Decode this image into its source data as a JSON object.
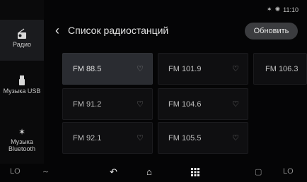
{
  "status": {
    "bluetooth_icon": "bluetooth-icon",
    "signal_icon": "network-icon",
    "time": "11:10"
  },
  "sidebar": {
    "items": [
      {
        "label": "Радио",
        "icon": "radio-icon",
        "active": true
      },
      {
        "label": "Музыка USB",
        "icon": "usb-icon",
        "active": false
      },
      {
        "label": "Музыка Bluetooth",
        "icon": "bluetooth-icon",
        "active": false
      }
    ]
  },
  "header": {
    "title": "Список радиостанций",
    "back_icon": "back-chevron-icon"
  },
  "update_button": {
    "label": "Обновить"
  },
  "stations": [
    {
      "freq": "FM 88.5",
      "active": true
    },
    {
      "freq": "FM 101.9",
      "active": false
    },
    {
      "freq": "FM 106.3",
      "active": false
    },
    {
      "freq": "FM 91.2",
      "active": false
    },
    {
      "freq": "FM 104.6",
      "active": false
    },
    {
      "freq": "FM 92.1",
      "active": false
    },
    {
      "freq": "FM 105.5",
      "active": false
    }
  ],
  "bottom_bar": {
    "left_temp": "LO",
    "right_temp": "LO",
    "icons": [
      "fan-icon",
      "back-icon",
      "home-icon",
      "apps-grid-icon",
      "car-icon"
    ]
  }
}
